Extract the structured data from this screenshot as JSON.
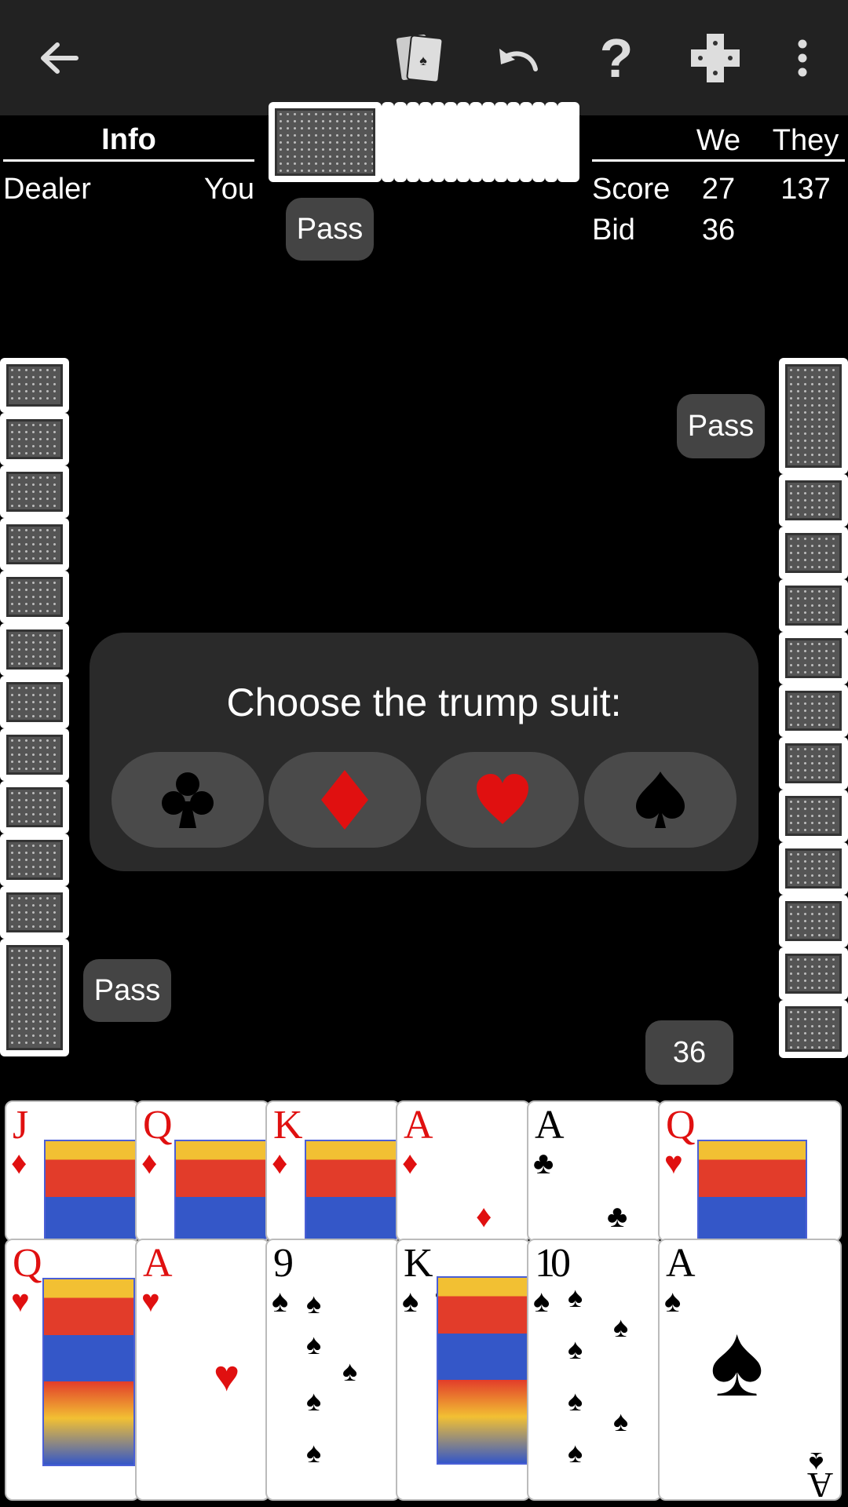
{
  "toolbar": {
    "back_icon": "arrow-left-icon",
    "cards_icon": "cards-icon",
    "undo_icon": "undo-icon",
    "help_icon": "help-icon",
    "help_glyph": "?",
    "puzzle_icon": "puzzle-icon",
    "menu_icon": "more-vert-icon"
  },
  "info": {
    "title": "Info",
    "dealer_label": "Dealer",
    "dealer_value": "You"
  },
  "score": {
    "we_label": "We",
    "they_label": "They",
    "score_label": "Score",
    "we_score": "27",
    "they_score": "137",
    "bid_label": "Bid",
    "we_bid": "36"
  },
  "bids": {
    "north": "Pass",
    "east": "Pass",
    "west": "Pass",
    "player": "36"
  },
  "dialog": {
    "title": "Choose the trump suit:",
    "suits": [
      {
        "name": "clubs",
        "glyph": "♣",
        "color": "#000000"
      },
      {
        "name": "diamonds",
        "glyph": "♦",
        "color": "#e01010"
      },
      {
        "name": "hearts",
        "glyph": "♥",
        "color": "#e01010"
      },
      {
        "name": "spades",
        "glyph": "♠",
        "color": "#000000"
      }
    ]
  },
  "hand": {
    "top_row": [
      {
        "rank": "J",
        "suit": "♦",
        "color": "red",
        "face": true
      },
      {
        "rank": "Q",
        "suit": "♦",
        "color": "red",
        "face": true
      },
      {
        "rank": "K",
        "suit": "♦",
        "color": "red",
        "face": true
      },
      {
        "rank": "A",
        "suit": "♦",
        "color": "red",
        "face": false
      },
      {
        "rank": "A",
        "suit": "♣",
        "color": "black",
        "face": false
      },
      {
        "rank": "Q",
        "suit": "♥",
        "color": "red",
        "face": true
      }
    ],
    "bottom_row": [
      {
        "rank": "Q",
        "suit": "♥",
        "color": "red",
        "face": true
      },
      {
        "rank": "A",
        "suit": "♥",
        "color": "red",
        "face": false
      },
      {
        "rank": "9",
        "suit": "♠",
        "color": "black",
        "face": false
      },
      {
        "rank": "K",
        "suit": "♠",
        "color": "black",
        "face": true
      },
      {
        "rank": "10",
        "suit": "♠",
        "color": "black",
        "face": false
      },
      {
        "rank": "A",
        "suit": "♠",
        "color": "black",
        "face": false
      }
    ]
  }
}
